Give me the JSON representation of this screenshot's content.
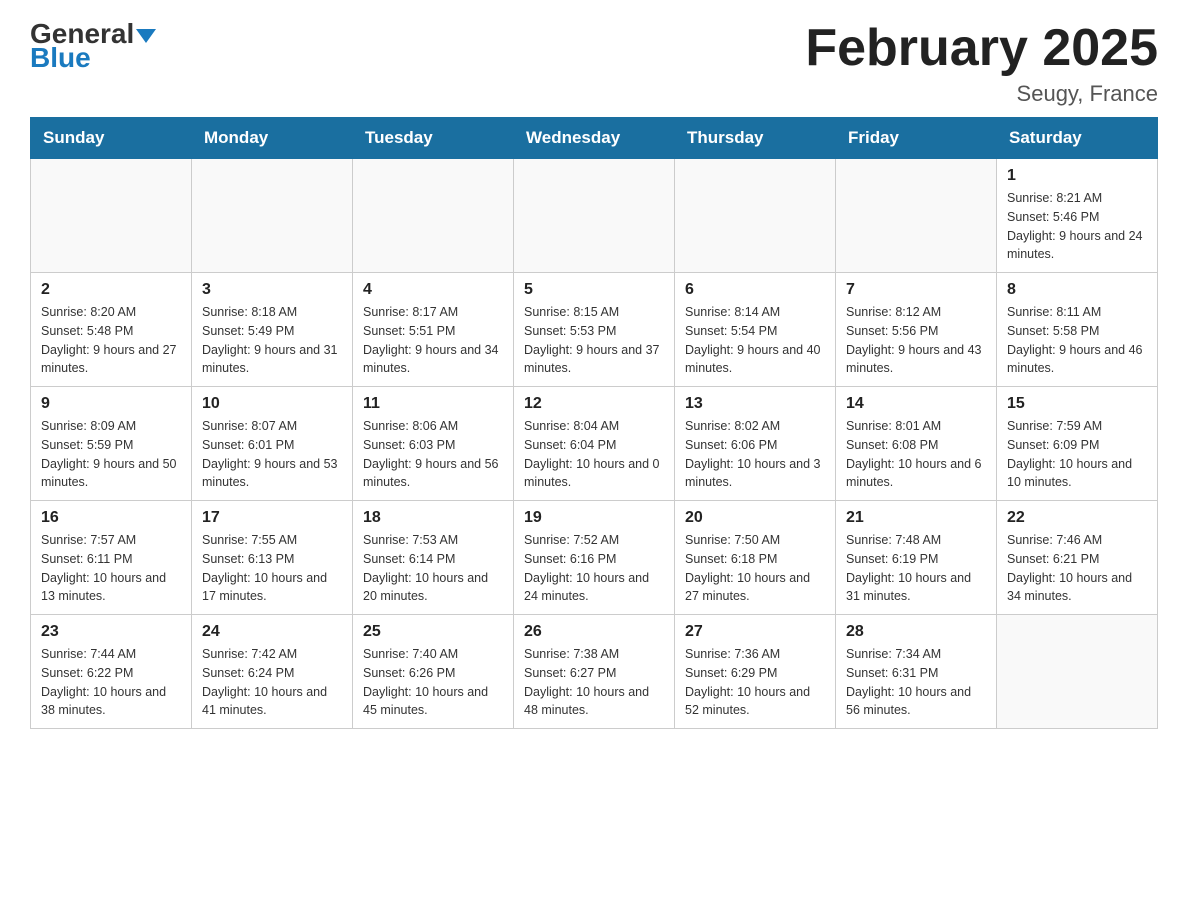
{
  "logo": {
    "general": "General",
    "blue": "Blue"
  },
  "title": "February 2025",
  "location": "Seugy, France",
  "days_of_week": [
    "Sunday",
    "Monday",
    "Tuesday",
    "Wednesday",
    "Thursday",
    "Friday",
    "Saturday"
  ],
  "weeks": [
    [
      {
        "day": "",
        "info": ""
      },
      {
        "day": "",
        "info": ""
      },
      {
        "day": "",
        "info": ""
      },
      {
        "day": "",
        "info": ""
      },
      {
        "day": "",
        "info": ""
      },
      {
        "day": "",
        "info": ""
      },
      {
        "day": "1",
        "info": "Sunrise: 8:21 AM\nSunset: 5:46 PM\nDaylight: 9 hours and 24 minutes."
      }
    ],
    [
      {
        "day": "2",
        "info": "Sunrise: 8:20 AM\nSunset: 5:48 PM\nDaylight: 9 hours and 27 minutes."
      },
      {
        "day": "3",
        "info": "Sunrise: 8:18 AM\nSunset: 5:49 PM\nDaylight: 9 hours and 31 minutes."
      },
      {
        "day": "4",
        "info": "Sunrise: 8:17 AM\nSunset: 5:51 PM\nDaylight: 9 hours and 34 minutes."
      },
      {
        "day": "5",
        "info": "Sunrise: 8:15 AM\nSunset: 5:53 PM\nDaylight: 9 hours and 37 minutes."
      },
      {
        "day": "6",
        "info": "Sunrise: 8:14 AM\nSunset: 5:54 PM\nDaylight: 9 hours and 40 minutes."
      },
      {
        "day": "7",
        "info": "Sunrise: 8:12 AM\nSunset: 5:56 PM\nDaylight: 9 hours and 43 minutes."
      },
      {
        "day": "8",
        "info": "Sunrise: 8:11 AM\nSunset: 5:58 PM\nDaylight: 9 hours and 46 minutes."
      }
    ],
    [
      {
        "day": "9",
        "info": "Sunrise: 8:09 AM\nSunset: 5:59 PM\nDaylight: 9 hours and 50 minutes."
      },
      {
        "day": "10",
        "info": "Sunrise: 8:07 AM\nSunset: 6:01 PM\nDaylight: 9 hours and 53 minutes."
      },
      {
        "day": "11",
        "info": "Sunrise: 8:06 AM\nSunset: 6:03 PM\nDaylight: 9 hours and 56 minutes."
      },
      {
        "day": "12",
        "info": "Sunrise: 8:04 AM\nSunset: 6:04 PM\nDaylight: 10 hours and 0 minutes."
      },
      {
        "day": "13",
        "info": "Sunrise: 8:02 AM\nSunset: 6:06 PM\nDaylight: 10 hours and 3 minutes."
      },
      {
        "day": "14",
        "info": "Sunrise: 8:01 AM\nSunset: 6:08 PM\nDaylight: 10 hours and 6 minutes."
      },
      {
        "day": "15",
        "info": "Sunrise: 7:59 AM\nSunset: 6:09 PM\nDaylight: 10 hours and 10 minutes."
      }
    ],
    [
      {
        "day": "16",
        "info": "Sunrise: 7:57 AM\nSunset: 6:11 PM\nDaylight: 10 hours and 13 minutes."
      },
      {
        "day": "17",
        "info": "Sunrise: 7:55 AM\nSunset: 6:13 PM\nDaylight: 10 hours and 17 minutes."
      },
      {
        "day": "18",
        "info": "Sunrise: 7:53 AM\nSunset: 6:14 PM\nDaylight: 10 hours and 20 minutes."
      },
      {
        "day": "19",
        "info": "Sunrise: 7:52 AM\nSunset: 6:16 PM\nDaylight: 10 hours and 24 minutes."
      },
      {
        "day": "20",
        "info": "Sunrise: 7:50 AM\nSunset: 6:18 PM\nDaylight: 10 hours and 27 minutes."
      },
      {
        "day": "21",
        "info": "Sunrise: 7:48 AM\nSunset: 6:19 PM\nDaylight: 10 hours and 31 minutes."
      },
      {
        "day": "22",
        "info": "Sunrise: 7:46 AM\nSunset: 6:21 PM\nDaylight: 10 hours and 34 minutes."
      }
    ],
    [
      {
        "day": "23",
        "info": "Sunrise: 7:44 AM\nSunset: 6:22 PM\nDaylight: 10 hours and 38 minutes."
      },
      {
        "day": "24",
        "info": "Sunrise: 7:42 AM\nSunset: 6:24 PM\nDaylight: 10 hours and 41 minutes."
      },
      {
        "day": "25",
        "info": "Sunrise: 7:40 AM\nSunset: 6:26 PM\nDaylight: 10 hours and 45 minutes."
      },
      {
        "day": "26",
        "info": "Sunrise: 7:38 AM\nSunset: 6:27 PM\nDaylight: 10 hours and 48 minutes."
      },
      {
        "day": "27",
        "info": "Sunrise: 7:36 AM\nSunset: 6:29 PM\nDaylight: 10 hours and 52 minutes."
      },
      {
        "day": "28",
        "info": "Sunrise: 7:34 AM\nSunset: 6:31 PM\nDaylight: 10 hours and 56 minutes."
      },
      {
        "day": "",
        "info": ""
      }
    ]
  ]
}
